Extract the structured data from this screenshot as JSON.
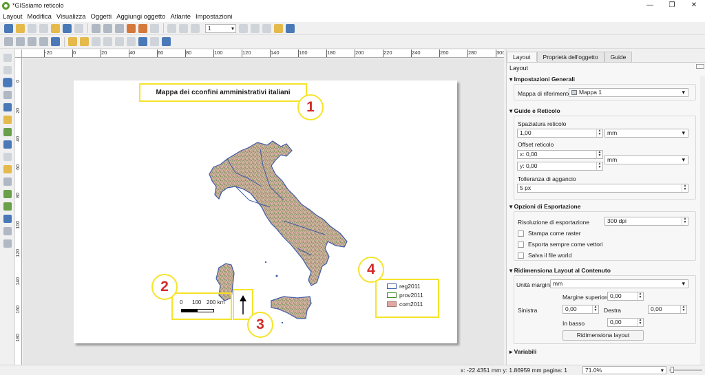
{
  "window": {
    "title": "*GISsiamo reticolo",
    "controls": [
      "—",
      "❐",
      "✕"
    ]
  },
  "menu": [
    "Layout",
    "Modifica",
    "Visualizza",
    "Oggetti",
    "Aggiungi oggetto",
    "Atlante",
    "Impostazioni"
  ],
  "toolbar": {
    "page_value": "1"
  },
  "ruler": {
    "top": [
      "-20",
      "0",
      "20",
      "40",
      "60",
      "80",
      "100",
      "120",
      "140",
      "160",
      "180",
      "200",
      "220",
      "240",
      "260",
      "280",
      "300"
    ],
    "left": [
      "0",
      "20",
      "40",
      "60",
      "80",
      "100",
      "120",
      "140",
      "160",
      "180"
    ]
  },
  "map": {
    "title": "Mappa dei cconfini amministrativi italiani",
    "callouts": [
      "1",
      "2",
      "3",
      "4"
    ],
    "scalebar": {
      "labels": [
        "0",
        "100",
        "200 km"
      ]
    },
    "legend": [
      {
        "label": "reg2011",
        "color": "#3d5ba8"
      },
      {
        "label": "prov2011",
        "color": "#3d8a2c"
      },
      {
        "label": "com2011",
        "color": "#e0a8a0"
      }
    ]
  },
  "panel": {
    "tabs": [
      "Layout",
      "Proprietà dell'oggetto",
      "Guide"
    ],
    "heading": "Layout",
    "general": {
      "title": "Impostazioni Generali",
      "ref_label": "Mappa di riferimento",
      "ref_value": "Mappa 1"
    },
    "guides": {
      "title": "Guide e Reticolo",
      "spacing_label": "Spaziatura reticolo",
      "spacing_value": "1,00",
      "spacing_unit": "mm",
      "offset_label": "Offset reticolo",
      "offset_x": "x: 0,00",
      "offset_y": "y: 0,00",
      "offset_unit": "mm",
      "tolerance_label": "Tolleranza di aggancio",
      "tolerance_value": "5 px"
    },
    "export": {
      "title": "Opzioni di Esportazione",
      "res_label": "Risoluzione di esportazione",
      "res_value": "300 dpi",
      "cb_raster": "Stampa come raster",
      "cb_vector": "Esporta sempre come vettori",
      "cb_world": "Salva il file world"
    },
    "resize": {
      "title": "Ridimensiona Layout al Contenuto",
      "units_label": "Unità margini",
      "units_value": "mm",
      "top_label": "Margine superiore",
      "top_value": "0,00",
      "left_label": "Sinistra",
      "left_value": "0,00",
      "right_label": "Destra",
      "right_value": "0,00",
      "bottom_label": "In basso",
      "bottom_value": "0,00",
      "button": "Ridimensiona layout"
    },
    "variables": {
      "title": "Variabili"
    }
  },
  "status": {
    "coords": "x: -22.4351 mm y: 1.86959 mm pagina: 1",
    "zoom": "71.0%"
  }
}
